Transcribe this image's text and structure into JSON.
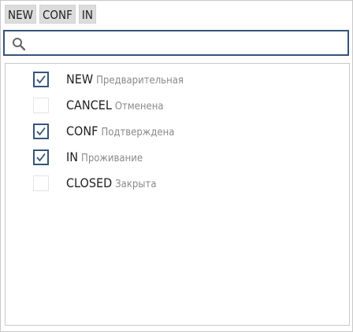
{
  "chips": [
    "NEW",
    "CONF",
    "IN"
  ],
  "search": {
    "placeholder": "",
    "value": ""
  },
  "items": [
    {
      "code": "NEW",
      "desc": "Предварительная",
      "checked": true
    },
    {
      "code": "CANCEL",
      "desc": "Отменена",
      "checked": false
    },
    {
      "code": "CONF",
      "desc": "Подтверждена",
      "checked": true
    },
    {
      "code": "IN",
      "desc": "Проживание",
      "checked": true
    },
    {
      "code": "CLOSED",
      "desc": "Закрыта",
      "checked": false
    }
  ],
  "colors": {
    "accent": "#35557a",
    "chip_bg": "#dcdcdc",
    "muted_text": "#8a8a8a"
  },
  "icons": {
    "search": "search-icon",
    "check": "checkmark-icon"
  }
}
